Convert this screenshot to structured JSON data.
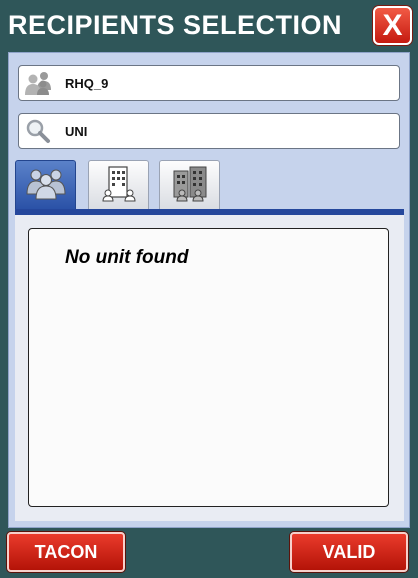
{
  "window": {
    "title": "RECIPIENTS SELECTION",
    "close_label": "X"
  },
  "fields": {
    "recipient": {
      "value": "RHQ_9",
      "icon": "group-icon"
    },
    "search": {
      "value": "UNI",
      "icon": "search-icon"
    }
  },
  "tabs": [
    {
      "icon": "group-icon",
      "active": true
    },
    {
      "icon": "building-icon",
      "active": false
    },
    {
      "icon": "buildings-icon",
      "active": false
    }
  ],
  "list": {
    "empty_message": "No unit found"
  },
  "buttons": {
    "left_label": "TACON",
    "right_label": "VALID"
  },
  "colors": {
    "background": "#2f5659",
    "panel": "#c6d3ec",
    "active_tab": "#2a51a6",
    "button_red": "#c51a10"
  }
}
